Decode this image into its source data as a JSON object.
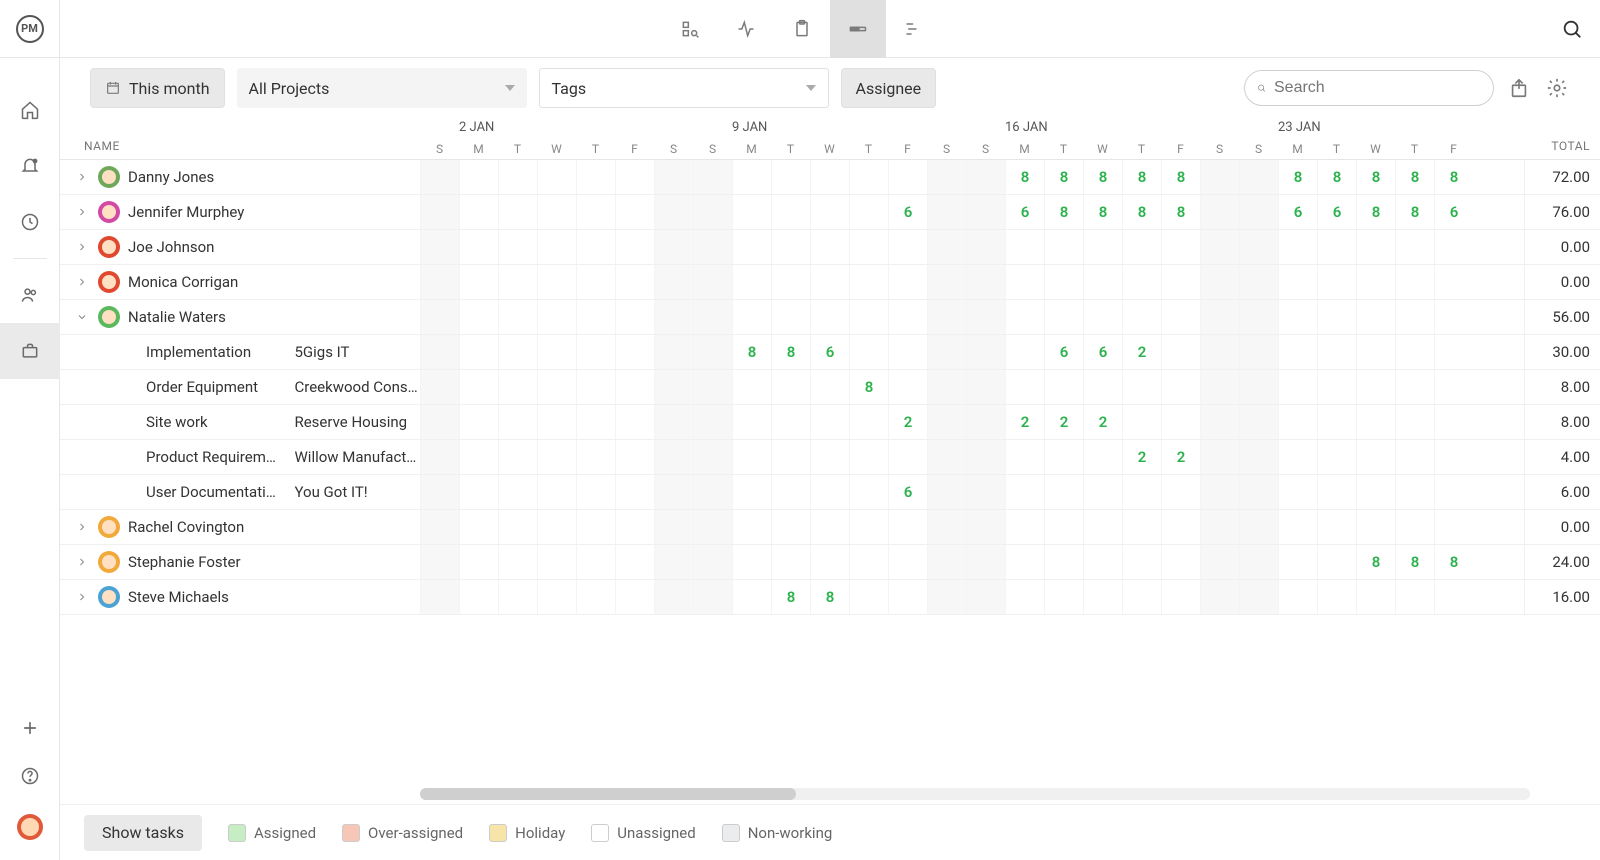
{
  "app": {
    "logo_text": "PM"
  },
  "toolbar": {
    "date_range": "This month",
    "projects_label": "All Projects",
    "tags_label": "Tags",
    "assignee_label": "Assignee",
    "search_placeholder": "Search",
    "show_tasks": "Show tasks"
  },
  "columns": {
    "name": "NAME",
    "total": "TOTAL",
    "day_letters": [
      "S",
      "M",
      "T",
      "W",
      "T",
      "F",
      "S",
      "S",
      "M",
      "T",
      "W",
      "T",
      "F",
      "S",
      "S",
      "M",
      "T",
      "W",
      "T",
      "F",
      "S",
      "S",
      "M",
      "T",
      "W",
      "T",
      "F"
    ],
    "weekend_idx": [
      0,
      6,
      7,
      13,
      14,
      20,
      21
    ],
    "date_groups": [
      {
        "label": "2 JAN",
        "at": 1
      },
      {
        "label": "9 JAN",
        "at": 8
      },
      {
        "label": "16 JAN",
        "at": 15
      },
      {
        "label": "23 JAN",
        "at": 22
      }
    ]
  },
  "people": [
    {
      "name": "Danny Jones",
      "avatar_bg": "#6fa85a",
      "expanded": false,
      "total": "72.00",
      "hours": {
        "15": "8",
        "16": "8",
        "17": "8",
        "18": "8",
        "19": "8",
        "22": "8",
        "23": "8",
        "24": "8",
        "25": "8",
        "26": "8"
      }
    },
    {
      "name": "Jennifer Murphey",
      "avatar_bg": "#d24aa5",
      "expanded": false,
      "total": "76.00",
      "hours": {
        "12": "6",
        "15": "6",
        "16": "8",
        "17": "8",
        "18": "8",
        "19": "8",
        "22": "6",
        "23": "6",
        "24": "8",
        "25": "8",
        "26": "6"
      }
    },
    {
      "name": "Joe Johnson",
      "avatar_bg": "#e0482f",
      "expanded": false,
      "total": "0.00",
      "hours": {}
    },
    {
      "name": "Monica Corrigan",
      "avatar_bg": "#e0482f",
      "expanded": false,
      "total": "0.00",
      "hours": {}
    },
    {
      "name": "Natalie Waters",
      "avatar_bg": "#5bb85d",
      "expanded": true,
      "total": "56.00",
      "hours": {},
      "tasks": [
        {
          "task": "Implementation",
          "project": "5Gigs IT",
          "total": "30.00",
          "hours": {
            "8": "8",
            "9": "8",
            "10": "6",
            "16": "6",
            "17": "6",
            "18": "2"
          }
        },
        {
          "task": "Order Equipment",
          "project": "Creekwood Constr.",
          "total": "8.00",
          "hours": {
            "11": "8"
          }
        },
        {
          "task": "Site work",
          "project": "Reserve Housing",
          "total": "8.00",
          "hours": {
            "12": "2",
            "15": "2",
            "16": "2",
            "17": "2"
          }
        },
        {
          "task": "Product Requirem…",
          "project": "Willow Manufactur.",
          "total": "4.00",
          "hours": {
            "18": "2",
            "19": "2"
          }
        },
        {
          "task": "User Documentati…",
          "project": "You Got IT!",
          "total": "6.00",
          "hours": {
            "12": "6"
          }
        }
      ]
    },
    {
      "name": "Rachel Covington",
      "avatar_bg": "#f2a93b",
      "expanded": false,
      "total": "0.00",
      "hours": {}
    },
    {
      "name": "Stephanie Foster",
      "avatar_bg": "#f2a93b",
      "expanded": false,
      "total": "24.00",
      "hours": {
        "24": "8",
        "25": "8",
        "26": "8"
      }
    },
    {
      "name": "Steve Michaels",
      "avatar_bg": "#4aa3d2",
      "expanded": false,
      "total": "16.00",
      "hours": {
        "9": "8",
        "10": "8"
      }
    }
  ],
  "legend": [
    {
      "label": "Assigned",
      "color": "#c7edc5"
    },
    {
      "label": "Over-assigned",
      "color": "#f6c7b6"
    },
    {
      "label": "Holiday",
      "color": "#f7e4a8"
    },
    {
      "label": "Unassigned",
      "color": "#ffffff"
    },
    {
      "label": "Non-working",
      "color": "#ebecee"
    }
  ]
}
